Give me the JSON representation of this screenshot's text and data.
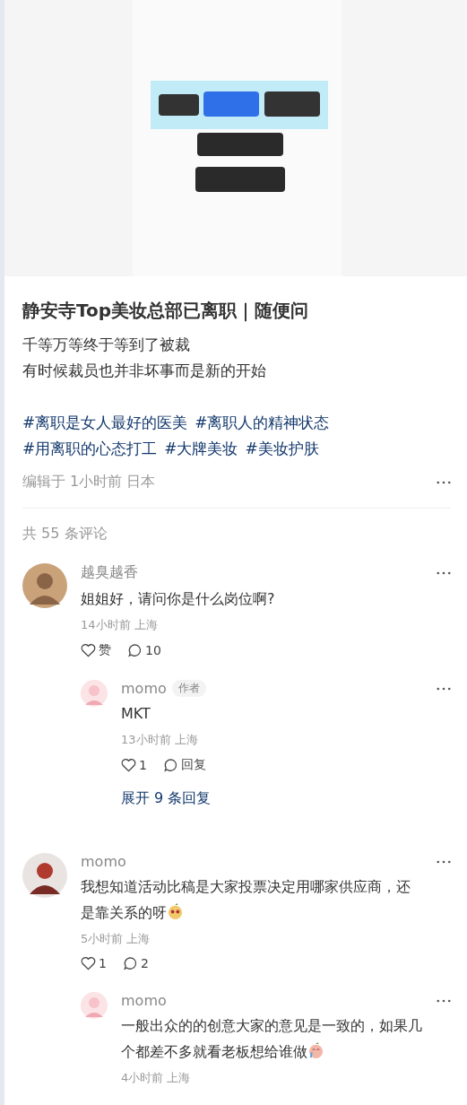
{
  "note": {
    "title": "静安寺Top美妆总部已离职｜随便问",
    "body": [
      "千等万等终于等到了被裁",
      "有时候裁员也并非坏事而是新的开始"
    ],
    "tags": [
      "#离职是女人最好的医美",
      "#离职人的精神状态",
      "#用离职的心态打工",
      "#大牌美妆",
      "#美妆护肤"
    ],
    "meta": "编辑于 1小时前 日本"
  },
  "comment_count": "共 55 条评论",
  "comments": [
    {
      "author": "越臭越香",
      "text": [
        "姐姐好，请问你是什么岗位啊?"
      ],
      "sticker": false,
      "time": "14小时前 上海",
      "likes": "赞",
      "replies_count": "10",
      "replies": [
        {
          "author": "momo",
          "author_badge": "作者",
          "text": [
            "MKT"
          ],
          "sticker": false,
          "time": "13小时前 上海",
          "likes": "1",
          "reply_label": "回复"
        }
      ],
      "expand": "展开 9 条回复"
    },
    {
      "author": "momo",
      "text": [
        "我想知道活动比稿是大家投票决定用哪家供应商，还",
        "是靠关系的呀"
      ],
      "sticker": true,
      "time": "5小时前 上海",
      "likes": "1",
      "replies_count": "2",
      "replies": [
        {
          "author": "momo",
          "text": [
            "一般出众的的创意大家的意见是一致的，如果几",
            "个都差不多就看老板想给谁做"
          ],
          "sticker": true,
          "time": "4小时前 上海"
        }
      ]
    }
  ]
}
